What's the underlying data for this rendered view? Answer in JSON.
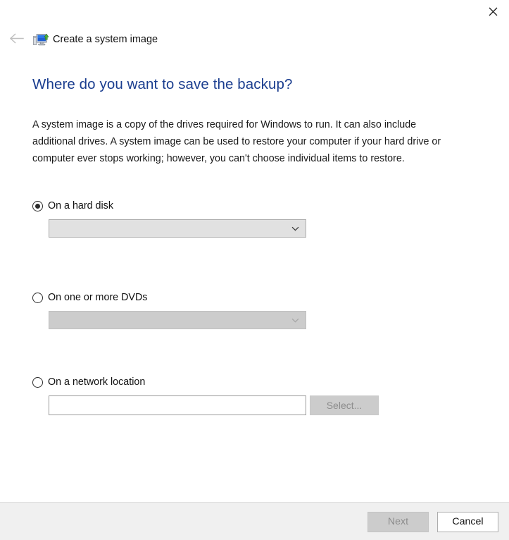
{
  "window": {
    "app_title": "Create a system image",
    "close_label": "✕",
    "back_label": "←",
    "app_icon": "system-image-monitor-icon"
  },
  "page": {
    "heading": "Where do you want to save the backup?",
    "body": "A system image is a copy of the drives required for Windows to run. It can also include additional drives. A system image can be used to restore your computer if your hard drive or computer ever stops working; however, you can't choose individual items to restore."
  },
  "options": [
    {
      "id": "hard-disk",
      "label": "On a hard disk",
      "selected": true,
      "control": "combo",
      "combo_value": "",
      "combo_disabled": false
    },
    {
      "id": "dvds",
      "label": "On one or more DVDs",
      "selected": false,
      "control": "combo",
      "combo_value": "",
      "combo_disabled": true
    },
    {
      "id": "network-location",
      "label": "On a network location",
      "selected": false,
      "control": "input-with-button",
      "input_value": "",
      "input_placeholder": "",
      "button_label": "Select...",
      "button_disabled": true
    }
  ],
  "footer": {
    "next_label": "Next",
    "next_disabled": true,
    "cancel_label": "Cancel",
    "cancel_disabled": false
  },
  "colors": {
    "heading_blue": "#1a3d8f",
    "footer_bg": "#f0f0f0",
    "combo_enabled_bg": "#e1e1e1",
    "combo_disabled_bg": "#cccccc",
    "disabled_text": "#8d8d8d"
  }
}
